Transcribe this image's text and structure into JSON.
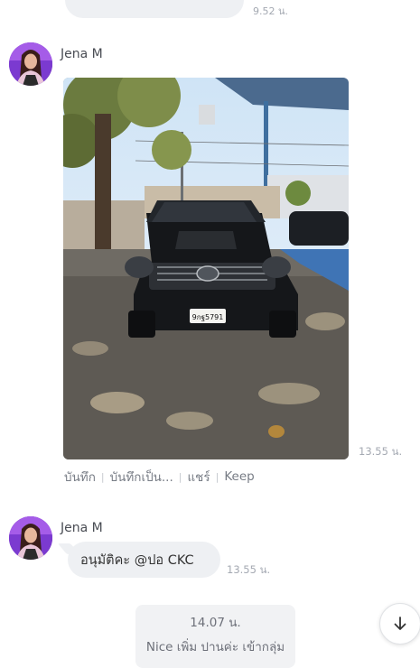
{
  "previous_message": {
    "time": "9.52 น."
  },
  "messages": [
    {
      "sender": "Jena M",
      "type": "image",
      "time": "13.55 น.",
      "actions": [
        "บันทึก",
        "บันทึกเป็น...",
        "แชร์",
        "Keep"
      ],
      "image": {
        "license_plate": "9กฐ5791"
      }
    },
    {
      "sender": "Jena M",
      "type": "text",
      "text": "อนุมัติคะ @ปอ CKC",
      "time": "13.55 น."
    }
  ],
  "system_note": {
    "time": "14.07 น.",
    "text": "Nice เพิ่ม ปานค่ะ เข้ากลุ่ม"
  },
  "icons": {
    "scroll": "arrow-down-icon",
    "avatar": "profile-photo"
  },
  "colors": {
    "bubble": "#eef0f3",
    "timestamp": "#a4a9b2",
    "action_text": "#777c85"
  }
}
